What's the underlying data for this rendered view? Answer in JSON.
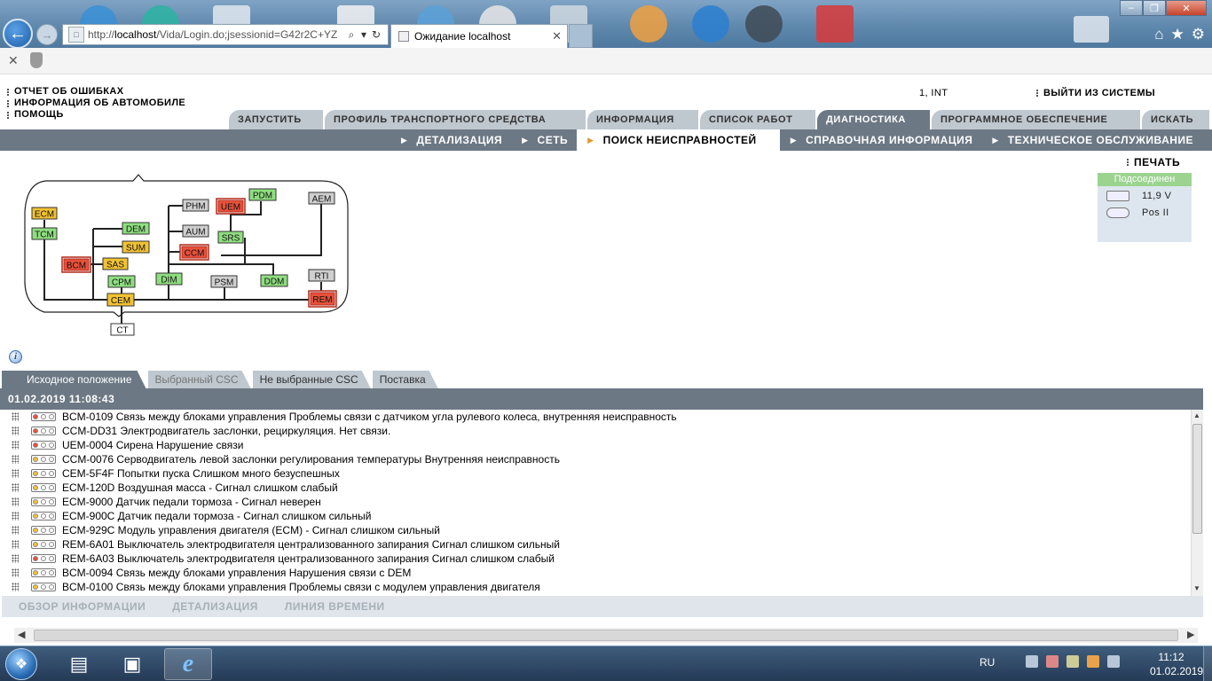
{
  "browser": {
    "address_prefix": "http://",
    "address_host": "localhost",
    "address_path": "/Vida/Login.do;jsessionid=G42r2C+YZ",
    "tab_title": "Ожидание localhost",
    "tab_close": "✕",
    "back_icon": "arrow-left-icon",
    "forward_icon": "arrow-right-icon",
    "search_icon": "⌕",
    "dropdown_icon": "▾",
    "refresh_icon": "↻",
    "home_icon": "⌂",
    "favorites_icon": "★",
    "settings_icon": "⚙",
    "cmd_close": "✕"
  },
  "app": {
    "header_links": [
      "ОТЧЕТ ОБ ОШИБКАХ",
      "ИНФОРМАЦИЯ ОБ АВТОМОБИЛЕ",
      "ПОМОЩЬ"
    ],
    "user_info": "1, INT",
    "logout": "ВЫЙТИ ИЗ СИСТЕМЫ",
    "main_tabs": [
      {
        "label": "ЗАПУСТИТЬ",
        "active": false
      },
      {
        "label": "ПРОФИЛЬ ТРАНСПОРТНОГО СРЕДСТВА",
        "active": false
      },
      {
        "label": "ИНФОРМАЦИЯ",
        "active": false
      },
      {
        "label": "СПИСОК РАБОТ",
        "active": false
      },
      {
        "label": "ДИАГНОСТИКА",
        "active": true
      },
      {
        "label": "ПРОГРАММНОЕ ОБЕСПЕЧЕНИЕ",
        "active": false
      },
      {
        "label": "ИСКАТЬ",
        "active": false
      }
    ],
    "sub_tabs": [
      {
        "label": "ДЕТАЛИЗАЦИЯ",
        "active": false
      },
      {
        "label": "СЕТЬ",
        "active": false
      },
      {
        "label": "ПОИСК НЕИСПРАВНОСТЕЙ",
        "active": true
      },
      {
        "label": "СПРАВОЧНАЯ ИНФОРМАЦИЯ",
        "active": false
      },
      {
        "label": "ТЕХНИЧЕСКОЕ ОБСЛУЖИВАНИЕ",
        "active": false
      }
    ],
    "print": "ПЕЧАТЬ",
    "status": {
      "header": "Подсоединен",
      "voltage": "11,9 V",
      "key_position": "Pos II"
    },
    "info_icon": "i",
    "data_tabs": [
      {
        "label": "Исходное положение",
        "state": "active"
      },
      {
        "label": "Выбранный CSC",
        "state": "muted"
      },
      {
        "label": "Не выбранные CSC",
        "state": "normal"
      },
      {
        "label": "Поставка",
        "state": "normal"
      }
    ],
    "timestamp": "01.02.2019 11:08:43",
    "faults": [
      {
        "text": "BCM-0109 Связь между блоками управления Проблемы связи с датчиком угла рулевого колеса, внутренняя неисправность",
        "status": "red"
      },
      {
        "text": "CCM-DD31 Электродвигатель заслонки, рециркуляция. Нет связи.",
        "status": "red"
      },
      {
        "text": "UEM-0004 Сирена Нарушение связи",
        "status": "red"
      },
      {
        "text": "CCM-0076 Серводвигатель левой заслонки регулирования температуры Внутренняя неисправность",
        "status": "yellow"
      },
      {
        "text": "CEM-5F4F Попытки пуска Слишком много безуспешных",
        "status": "yellow"
      },
      {
        "text": "ECM-120D Воздушная масса - Сигнал слишком слабый",
        "status": "yellow"
      },
      {
        "text": "ECM-9000 Датчик педали тормоза - Сигнал неверен",
        "status": "yellow"
      },
      {
        "text": "ECM-900C Датчик педали тормоза - Сигнал слишком сильный",
        "status": "yellow"
      },
      {
        "text": "ECM-929C Модуль управления двигателя (ECM) - Сигнал слишком сильный",
        "status": "yellow"
      },
      {
        "text": "REM-6A01 Выключатель электродвигателя централизованного запирания Сигнал слишком сильный",
        "status": "yellow"
      },
      {
        "text": "REM-6A03 Выключатель электродвигателя централизованного запирания Сигнал слишком слабый",
        "status": "red"
      },
      {
        "text": "BCM-0094 Связь между блоками управления Нарушения связи с DEM",
        "status": "yellow"
      },
      {
        "text": "BCM-0100 Связь между блоками управления Проблемы связи с модулем управления двигателя",
        "status": "yellow"
      }
    ],
    "bottom_tabs": [
      "ОБЗОР ИНФОРМАЦИИ",
      "ДЕТАЛИЗАЦИЯ",
      "ЛИНИЯ ВРЕМЕНИ"
    ]
  },
  "diagram": {
    "modules": [
      {
        "id": "ECM",
        "status": "yellow"
      },
      {
        "id": "TCM",
        "status": "green"
      },
      {
        "id": "DEM",
        "status": "green"
      },
      {
        "id": "SUM",
        "status": "yellow"
      },
      {
        "id": "BCM",
        "status": "red"
      },
      {
        "id": "SAS",
        "status": "yellow"
      },
      {
        "id": "CPM",
        "status": "green"
      },
      {
        "id": "CEM",
        "status": "yellow"
      },
      {
        "id": "CT",
        "status": "white"
      },
      {
        "id": "PHM",
        "status": "gray"
      },
      {
        "id": "UEM",
        "status": "red"
      },
      {
        "id": "PDM",
        "status": "green"
      },
      {
        "id": "AUM",
        "status": "gray"
      },
      {
        "id": "SRS",
        "status": "green"
      },
      {
        "id": "CCM",
        "status": "red"
      },
      {
        "id": "DIM",
        "status": "green"
      },
      {
        "id": "PSM",
        "status": "gray"
      },
      {
        "id": "DDM",
        "status": "green"
      },
      {
        "id": "AEM",
        "status": "gray"
      },
      {
        "id": "RTI",
        "status": "gray"
      },
      {
        "id": "REM",
        "status": "red"
      }
    ]
  },
  "taskbar": {
    "start_icon": "windows-start-icon",
    "items": [
      {
        "name": "explorer",
        "glyph": "▤"
      },
      {
        "name": "app",
        "glyph": "▣"
      },
      {
        "name": "ie",
        "glyph": "e"
      }
    ],
    "lang": "RU",
    "time": "11:12",
    "date": "01.02.2019"
  },
  "colors": {
    "accent_gray": "#6c7884",
    "tab_gray": "#bfc7cf",
    "status_green": "#9bd38f",
    "module_red": "#e8503a",
    "module_yellow": "#f2c233",
    "module_green": "#8fde80",
    "module_gray": "#cfcfcf",
    "module_white": "#ffffff"
  }
}
